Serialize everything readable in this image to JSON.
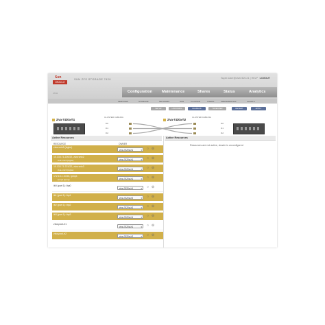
{
  "header": {
    "brand_top": "Sun",
    "brand_bottom": "ORACLE",
    "app_name": "SUN ZFS STORAGE 7420",
    "hostname": "ziva",
    "user_info": "Super-User@ziva7420-h1 | HELP",
    "logout": "LOGOUT"
  },
  "main_nav": [
    "Configuration",
    "Maintenance",
    "Shares",
    "Status",
    "Analytics"
  ],
  "sub_nav": [
    "SERVICES",
    "STORAGE",
    "NETWORK",
    "SAN",
    "CLUSTER",
    "USERS",
    "PREFERENCES",
    "ALERTS"
  ],
  "toolbar": {
    "buttons": [
      "SETUP",
      "UNCONFIG",
      "FAILBACK",
      "TAKEOVER",
      "REVERT",
      "APPLY"
    ]
  },
  "heads": {
    "left_name": "ziva-7420a-h1",
    "right_name": "ziva-7420a-h2",
    "left_cable": "CLUSTER CABLING",
    "right_cable": "CLUSTER CABLING",
    "ports": [
      "ib0",
      "ib1",
      "ib2",
      "ib0",
      "ib1",
      "ib2"
    ]
  },
  "left_panel": {
    "title": "Active Resources",
    "col_resource": "RESOURCE",
    "col_owner": "OWNER",
    "rows": [
      {
        "name": "ziva-vnic5 (ixgbe)",
        "sub": "",
        "owner": "ziva-7420a-h1"
      },
      {
        "name": "10.133.71.220/22, ziva-vnic2",
        "sub": "ziva-vnic2 (ixgbe)",
        "owner": "ziva-7420a-h1"
      },
      {
        "name": "10.133.71.221/22, ziva-vnic3",
        "sub": "ziva-vnic3 (ixgbe)",
        "owner": "ziva-7420a-h1"
      },
      {
        "name": "172.16.1.10/24, ipmp1",
        "sub": "ipmp1 (ipmp)",
        "owner": "ziva-7420a-h1"
      },
      {
        "name": "ib0 (part 1): ibp0",
        "sub": "",
        "owner": "ziva-7420a-h1"
      },
      {
        "name": "ib1 (part 1): ibp1",
        "sub": "",
        "owner": "ziva-7420a-h2"
      },
      {
        "name": "ib2 (part 1): ibp2",
        "sub": "",
        "owner": "ziva-7420a-h2"
      },
      {
        "name": "ib3 (part 1): ibp3",
        "sub": "",
        "owner": "ziva-7420a-h1"
      },
      {
        "name": "ziva-pool-h1",
        "sub": "",
        "owner": "ziva-7420a-h1"
      },
      {
        "name": "ziva-pool-h2",
        "sub": "",
        "owner": "ziva-7420a-h2"
      }
    ]
  },
  "right_panel": {
    "title": "Active Resources",
    "empty_text": "Resources are not active, cluster is unconfigured"
  },
  "colors": {
    "accent_gold": "#d1b04a",
    "nav_gray": "#8f8f8f",
    "button_blue": "#5b6f99"
  }
}
